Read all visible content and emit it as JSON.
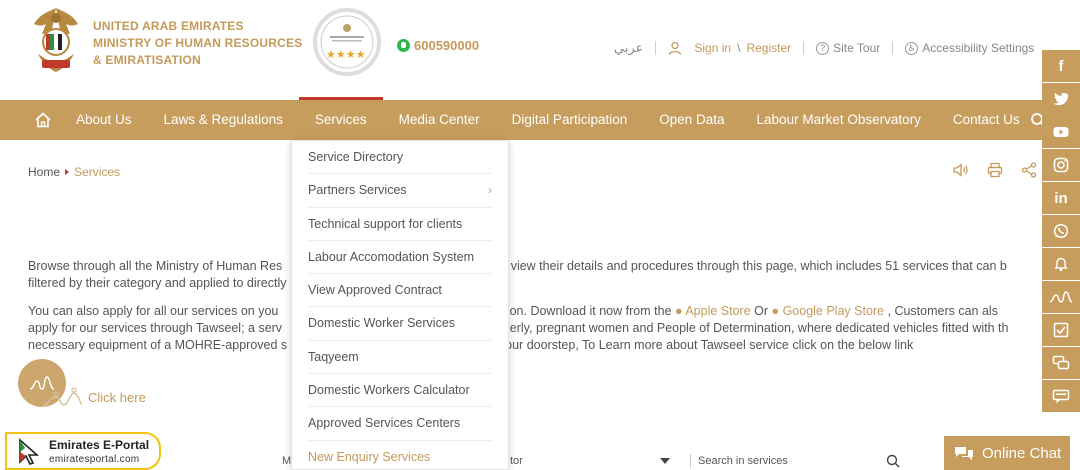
{
  "header": {
    "ministry_line1": "UNITED ARAB EMIRATES",
    "ministry_line2": "MINISTRY OF HUMAN RESOURCES",
    "ministry_line3": "& EMIRATISATION",
    "phone": "600590000",
    "language": "عربي",
    "sign_in": "Sign in",
    "slash": "\\",
    "register": "Register",
    "site_tour": "Site Tour",
    "accessibility": "Accessibility Settings"
  },
  "nav": {
    "items": [
      {
        "label": "About Us"
      },
      {
        "label": "Laws & Regulations"
      },
      {
        "label": "Services"
      },
      {
        "label": "Media Center"
      },
      {
        "label": "Digital Participation"
      },
      {
        "label": "Open Data"
      },
      {
        "label": "Labour Market Observatory"
      },
      {
        "label": "Contact Us"
      }
    ]
  },
  "breadcrumb": {
    "home": "Home",
    "current": "Services"
  },
  "dropdown": {
    "items": [
      {
        "label": "Service Directory"
      },
      {
        "label": "Partners Services",
        "chevron": "›"
      },
      {
        "label": "Technical support for clients"
      },
      {
        "label": "Labour Accomodation System"
      },
      {
        "label": "View Approved Contract"
      },
      {
        "label": "Domestic Worker Services"
      },
      {
        "label": "Taqyeem"
      },
      {
        "label": "Domestic Workers Calculator"
      },
      {
        "label": "Approved Services Centers"
      },
      {
        "label": "New Enquiry Services"
      }
    ]
  },
  "content": {
    "para1_left": "Browse through all the Ministry of Human Res",
    "para1_right": "d view their details and procedures through this page, which includes 51 services that can b",
    "para1_line2": "filtered by their category and applied to directly",
    "para2_l1_left": "You can also apply for all our services on you",
    "para2_l1_mid": "ation. Download it now from the",
    "apple_store": "Apple Store",
    "or": "Or",
    "google_play": "Google Play Store",
    "para2_l1_right": ", Customers can als",
    "para2_l2_left": "apply for our services through Tawseel; a serv",
    "para2_l2_right": "lderly, pregnant women and People of Determination, where dedicated vehicles fitted with th",
    "para2_l3_left": "necessary equipment of a MOHRE-approved s",
    "para2_l3_right": "our doorstep, To Learn more about Tawseel service click on the below link",
    "click_here": "Click here"
  },
  "search_row": {
    "left_fragment": "M",
    "mid_fragment": "tor",
    "placeholder": "Search in services"
  },
  "brand": {
    "name": "Emirates E-Portal",
    "url": "emiratesportal.com"
  },
  "online_chat": "Online Chat",
  "social": {
    "facebook": "f",
    "linkedin": "in"
  },
  "colors": {
    "brand_gold": "#c79d5e",
    "text_gold": "#c49a5a",
    "active_red": "#c0392b",
    "whatsapp_green": "#2eb84c"
  }
}
